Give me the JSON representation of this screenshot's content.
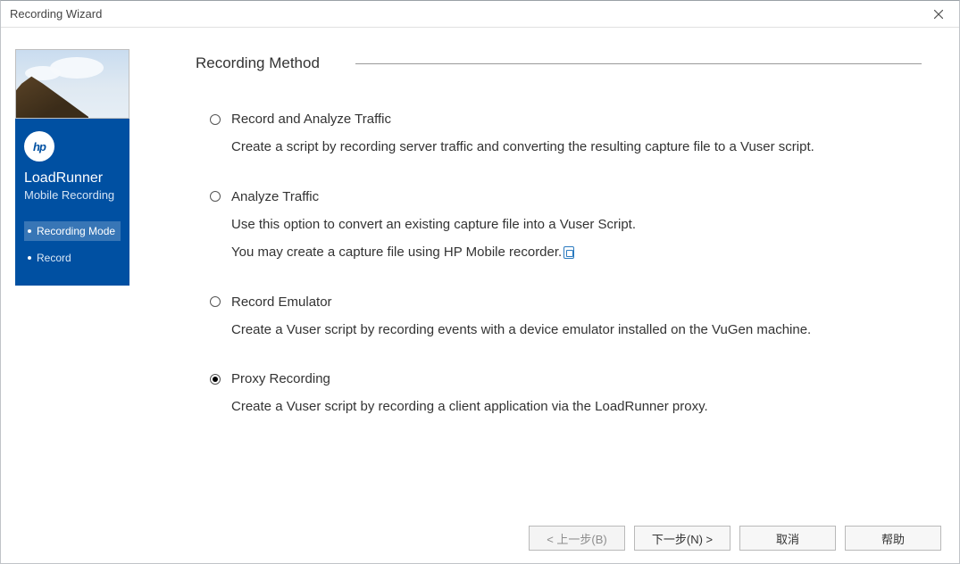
{
  "titlebar": {
    "title": "Recording Wizard"
  },
  "sidebar": {
    "brand_line1": "LoadRunner",
    "brand_line2": "Mobile Recording",
    "steps": [
      {
        "label": "Recording Mode"
      },
      {
        "label": "Record"
      }
    ]
  },
  "main": {
    "section_title": "Recording Method",
    "options": [
      {
        "label": "Record and Analyze Traffic",
        "desc1": "Create a script by recording server traffic and converting the resulting capture file to a Vuser script.",
        "selected": false
      },
      {
        "label": "Analyze Traffic",
        "desc1": "Use this option to convert an existing capture file into a Vuser Script.",
        "desc2": "You may create a capture file using HP Mobile recorder.",
        "selected": false
      },
      {
        "label": "Record Emulator",
        "desc1": "Create a Vuser script by recording events with a device emulator installed on the VuGen machine.",
        "selected": false
      },
      {
        "label": "Proxy Recording",
        "desc1": "Create a Vuser script by recording a client application via the LoadRunner proxy.",
        "selected": true
      }
    ]
  },
  "footer": {
    "back": "< 上一步(B)",
    "next": "下一步(N) >",
    "cancel": "取消",
    "help": "帮助"
  }
}
